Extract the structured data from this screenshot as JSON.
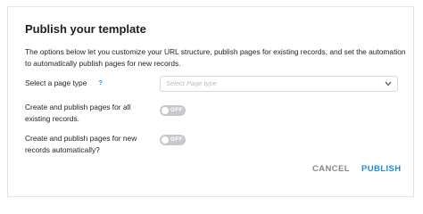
{
  "dialog": {
    "title": "Publish your template",
    "description": "The options below let you customize your URL structure, publish pages for existing records, and set the automation to automatically publish pages for new records."
  },
  "page_type": {
    "label": "Select a page type",
    "help_icon": "?",
    "placeholder": "Select Page type"
  },
  "existing_records": {
    "label_line1": "Create and publish pages for all",
    "label_line2": "existing records.",
    "toggle_state": "OFF"
  },
  "new_records": {
    "label_line1": "Create and publish pages for new",
    "label_line2": "records automatically?",
    "toggle_state": "OFF"
  },
  "actions": {
    "cancel_label": "CANCEL",
    "publish_label": "PUBLISH"
  },
  "colors": {
    "accent": "#1f8de6",
    "toggle_off": "#c5c8cc",
    "muted_button": "#818891"
  },
  "icons": {
    "help": "question-mark-icon",
    "dropdown": "chevron-down-icon"
  }
}
